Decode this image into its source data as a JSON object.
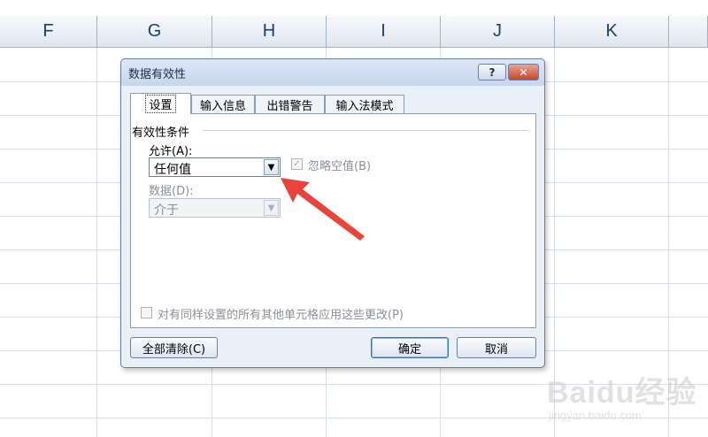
{
  "spreadsheet": {
    "columns": [
      "F",
      "G",
      "H",
      "I",
      "J",
      "K"
    ]
  },
  "dialog": {
    "title": "数据有效性",
    "help_label": "?",
    "close_label": "✕",
    "tabs": [
      {
        "label": "设置",
        "active": true
      },
      {
        "label": "输入信息",
        "active": false
      },
      {
        "label": "出错警告",
        "active": false
      },
      {
        "label": "输入法模式",
        "active": false
      }
    ],
    "group_label": "有效性条件",
    "allow_label": "允许(A):",
    "allow_value": "任何值",
    "ignore_blank_label": "忽略空值(B)",
    "ignore_blank_checked": true,
    "data_label": "数据(D):",
    "data_value": "介于",
    "apply_all_label": "对有同样设置的所有其他单元格应用这些更改(P)",
    "apply_all_checked": false,
    "buttons": {
      "clear_all": "全部清除(C)",
      "ok": "确定",
      "cancel": "取消"
    }
  },
  "annotation": {
    "arrow_color": "#e8443a"
  },
  "watermark": {
    "text": "Baidu经验",
    "sub": "jingyan.baidu.com"
  }
}
